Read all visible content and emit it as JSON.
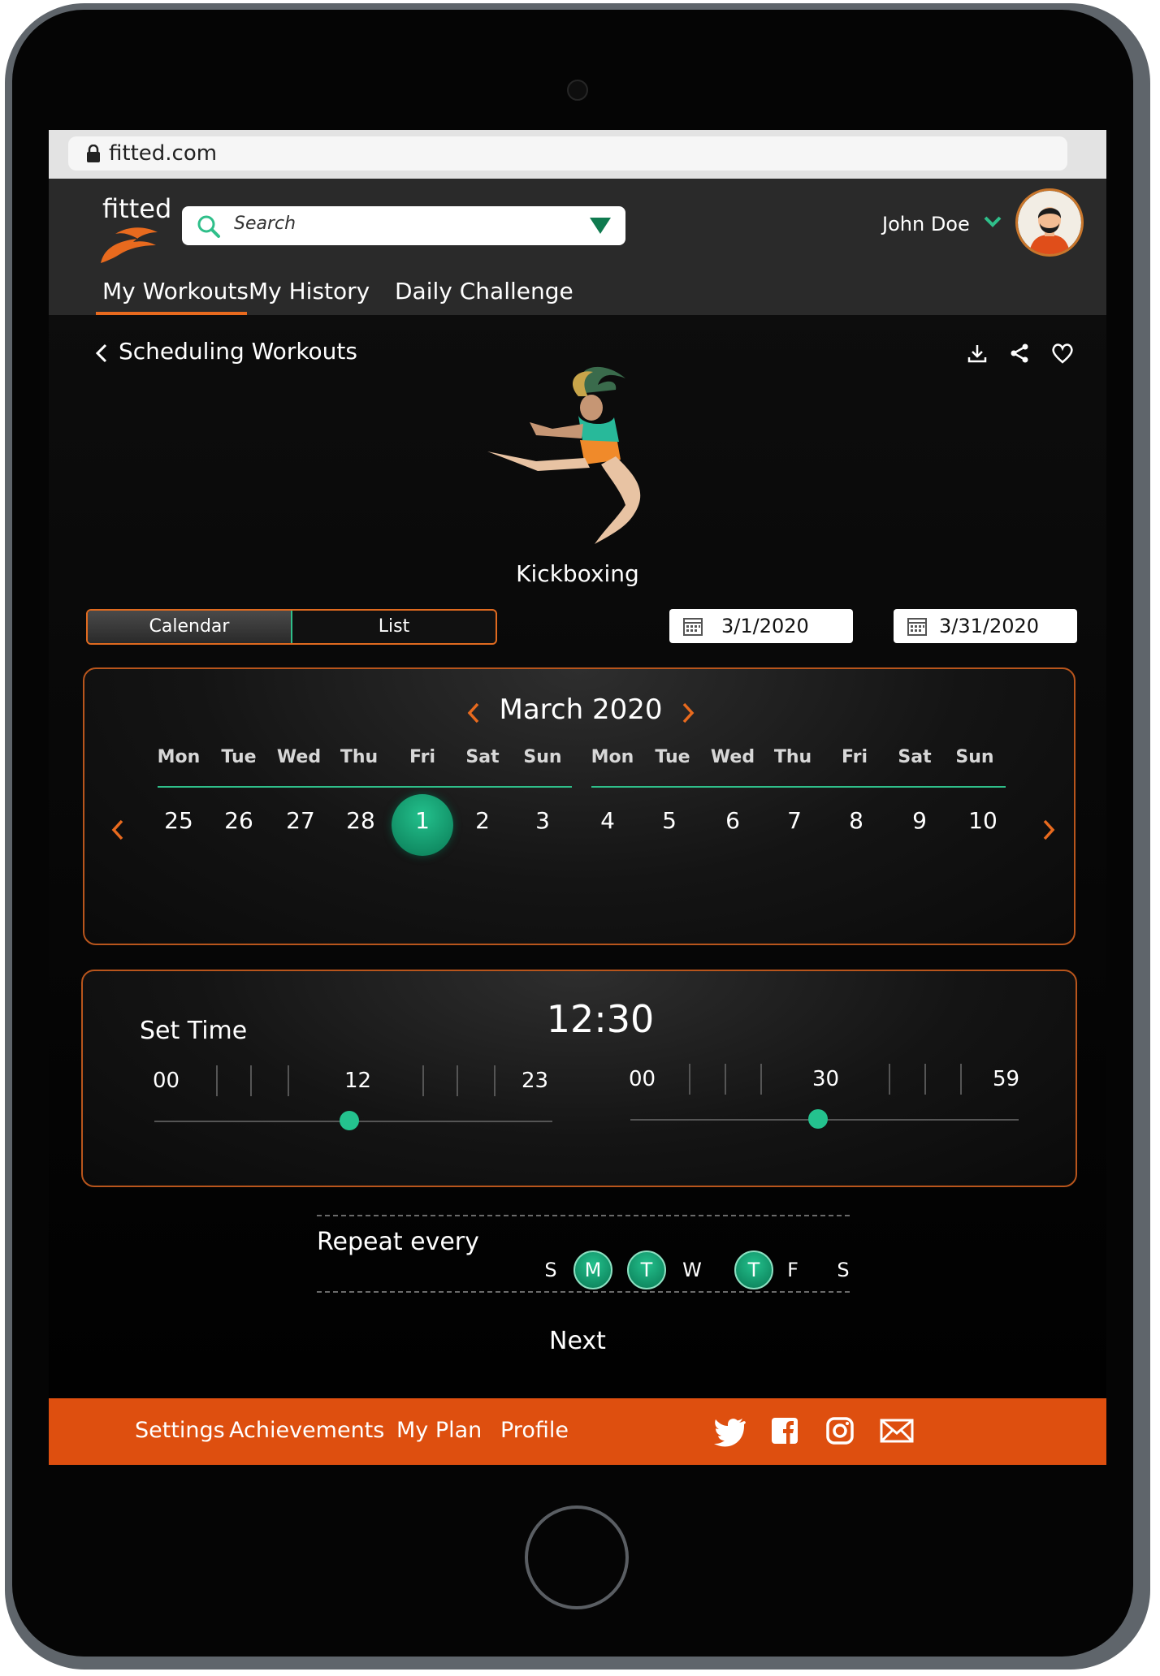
{
  "browser": {
    "url": "fitted.com"
  },
  "header": {
    "logo": "fitted",
    "search_placeholder": "Search",
    "user_name": "John Doe",
    "tabs": [
      {
        "label": "My Workouts",
        "active": true
      },
      {
        "label": "My History",
        "active": false
      },
      {
        "label": "Daily Challenge",
        "active": false
      }
    ]
  },
  "page": {
    "title": "Scheduling Workouts",
    "actions": [
      "download-icon",
      "share-icon",
      "heart-icon"
    ],
    "workout_name": "Kickboxing"
  },
  "view_toggle": {
    "calendar": "Calendar",
    "list": "List",
    "selected": "Calendar"
  },
  "date_range": {
    "start": "3/1/2020",
    "end": "3/31/2020"
  },
  "calendar": {
    "month": "March 2020",
    "week1": {
      "days": [
        "Mon",
        "Tue",
        "Wed",
        "Thu",
        "Fri",
        "Sat",
        "Sun"
      ],
      "dates": [
        "25",
        "26",
        "27",
        "28",
        "1",
        "2",
        "3"
      ]
    },
    "week2": {
      "days": [
        "Mon",
        "Tue",
        "Wed",
        "Thu",
        "Fri",
        "Sat",
        "Sun"
      ],
      "dates": [
        "4",
        "5",
        "6",
        "7",
        "8",
        "9",
        "10"
      ]
    },
    "selected_date": "1"
  },
  "time": {
    "label": "Set Time",
    "value": "12:30",
    "hours": {
      "min": "00",
      "mid": "12",
      "max": "23",
      "selected": 12
    },
    "minutes": {
      "min": "00",
      "mid": "30",
      "max": "59",
      "selected": 30
    }
  },
  "repeat": {
    "label": "Repeat every",
    "days": [
      {
        "letter": "S",
        "on": false
      },
      {
        "letter": "M",
        "on": true
      },
      {
        "letter": "T",
        "on": true
      },
      {
        "letter": "W",
        "on": false
      },
      {
        "letter": "T",
        "on": true
      },
      {
        "letter": "F",
        "on": false
      },
      {
        "letter": "S",
        "on": false
      }
    ]
  },
  "next_label": "Next",
  "footer": {
    "links": [
      "Settings",
      "Achievements",
      "My Plan",
      "Profile"
    ],
    "social": [
      "twitter-icon",
      "facebook-icon",
      "instagram-icon",
      "email-icon"
    ]
  },
  "colors": {
    "accent": "#de4f0f",
    "green": "#24c28e",
    "background": "#0a0a0a"
  }
}
